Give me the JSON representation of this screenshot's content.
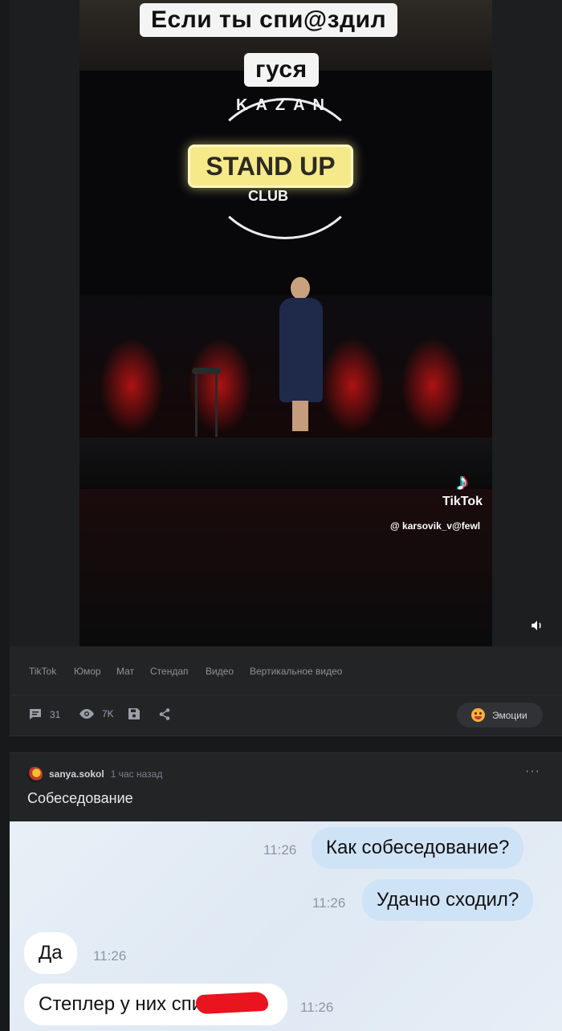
{
  "video": {
    "caption_line1": "Если ты спи@здил",
    "caption_line2": "гуся",
    "logo_top": "KAZAN",
    "logo_sign": "STAND UP",
    "logo_bottom": "CLUB",
    "watermark_brand": "TikTok",
    "watermark_user": "@ karsovik_v@fewl"
  },
  "tags": [
    "TikTok",
    "Юмор",
    "Мат",
    "Стендап",
    "Видео",
    "Вертикальное видео"
  ],
  "actions": {
    "comments_count": "31",
    "views_count": "7K",
    "emotions_label": "Эмоции"
  },
  "post2": {
    "author": "sanya.sokol",
    "time": "1 час назад",
    "more": "···",
    "title": "Собеседование",
    "chat": {
      "msg1": "Как собеседование?",
      "time1": "11:26",
      "msg2": "Удачно сходил?",
      "time2": "11:26",
      "msg3": "Да",
      "time3": "11:26",
      "msg4": "Степлер у них спи",
      "time4": "11:26"
    }
  },
  "colors": {
    "page_bg": "#18191a",
    "card_bg": "#222426",
    "tag_text": "#8e9399",
    "out_bubble": "#cfe3f7",
    "in_bubble": "#ffffff",
    "redaction": "#e8141e"
  }
}
